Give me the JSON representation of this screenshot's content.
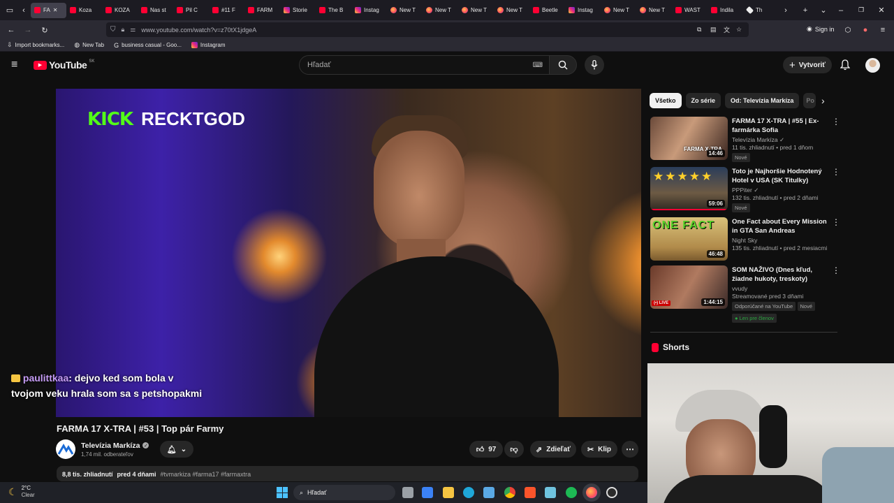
{
  "browser": {
    "tabs": [
      {
        "label": "FA",
        "icon": "youtube",
        "active": true
      },
      {
        "label": "Koza",
        "icon": "youtube"
      },
      {
        "label": "KOZA",
        "icon": "youtube"
      },
      {
        "label": "Nas st",
        "icon": "youtube"
      },
      {
        "label": "Pil C",
        "icon": "youtube"
      },
      {
        "label": "#11 F",
        "icon": "youtube"
      },
      {
        "label": "FARM",
        "icon": "youtube"
      },
      {
        "label": "Storie",
        "icon": "instagram"
      },
      {
        "label": "The B",
        "icon": "youtube"
      },
      {
        "label": "Instag",
        "icon": "instagram"
      },
      {
        "label": "New T",
        "icon": "firefox"
      },
      {
        "label": "New T",
        "icon": "firefox"
      },
      {
        "label": "New T",
        "icon": "firefox"
      },
      {
        "label": "New T",
        "icon": "firefox"
      },
      {
        "label": "Beetle",
        "icon": "youtube"
      },
      {
        "label": "Instag",
        "icon": "instagram"
      },
      {
        "label": "New T",
        "icon": "firefox"
      },
      {
        "label": "New T",
        "icon": "firefox"
      },
      {
        "label": "WAST",
        "icon": "youtube"
      },
      {
        "label": "Indila",
        "icon": "youtube"
      },
      {
        "label": "Th",
        "icon": "generic"
      }
    ],
    "url": "www.youtube.com/watch?v=z70tX1jdgeA",
    "sign_in": "Sign in",
    "bookmarks": [
      {
        "label": "Import bookmarks...",
        "icon": "import"
      },
      {
        "label": "New Tab",
        "icon": "globe"
      },
      {
        "label": "business casual - Goo...",
        "icon": "google"
      },
      {
        "label": "Instagram",
        "icon": "instagram"
      }
    ]
  },
  "youtube": {
    "logo_text": "YouTube",
    "region": "SK",
    "search_placeholder": "Hľadať",
    "create_label": "Vytvoriť"
  },
  "video": {
    "overlay_brand": "KICK",
    "overlay_user": "RECKTGOD",
    "chat_user": "paulittkaa",
    "chat_text": ": dejvo ked som bola v tvojom veku hrala som sa s petshopakmi",
    "title": "FARMA 17 X-TRA | #53 | Top pár Farmy",
    "channel_name": "Televízia Markíza",
    "subscribers": "1,74 mil. odberateľov",
    "likes": "97",
    "share_label": "Zdieľať",
    "clip_label": "Klip",
    "views": "8,8 tis. zhliadnutí",
    "date": "pred 4 dňami",
    "hashtags": "#tvmarkiza #farma17 #farmaxtra"
  },
  "sidebar": {
    "chips": [
      "Všetko",
      "Zo série",
      "Od: Televízia Markíza",
      "Po"
    ],
    "recommendations": [
      {
        "title": "FARMA 17 X-TRA | #55 | Ex-farmárka Sofia",
        "channel": "Televízia Markíza",
        "meta": "11 tis. zhliadnutí • pred 1 dňom",
        "badge": "Nové",
        "duration": "14:46",
        "thumb_text": "FARMA X-TRA"
      },
      {
        "title": "Toto je Najhoršie Hodnotený Hotel v USA (SK Titulky)",
        "channel": "PPPiter",
        "meta": "132 tis. zhliadnutí • pred 2 dňami",
        "badge": "Nové",
        "duration": "59:06",
        "thumb_text": "★★★★★"
      },
      {
        "title": "One Fact about Every Mission in GTA San Andreas",
        "channel": "Night Sky",
        "meta": "135 tis. zhliadnutí • pred 2 mesiacmi",
        "badge": "",
        "duration": "46:48",
        "thumb_text": "ONE FACT"
      },
      {
        "title": "SOM NAŽIVO (Dnes kľud, žiadne hukoty, treskoty)",
        "channel": "vvudy",
        "meta": "Streamované pred 3 dňami",
        "badge": "Odporúčané na YouTube",
        "badge2": "Nové",
        "members": "Len pre členov",
        "duration": "1:44:15",
        "live_label": "(•) LIVE"
      }
    ],
    "shorts_label": "Shorts"
  },
  "taskbar": {
    "temperature": "2°C",
    "weather": "Clear",
    "search_label": "Hľadať"
  },
  "colors": {
    "youtube_red": "#ff0033",
    "kick_green": "#53fc18",
    "chat_user": "#c59cf5"
  }
}
